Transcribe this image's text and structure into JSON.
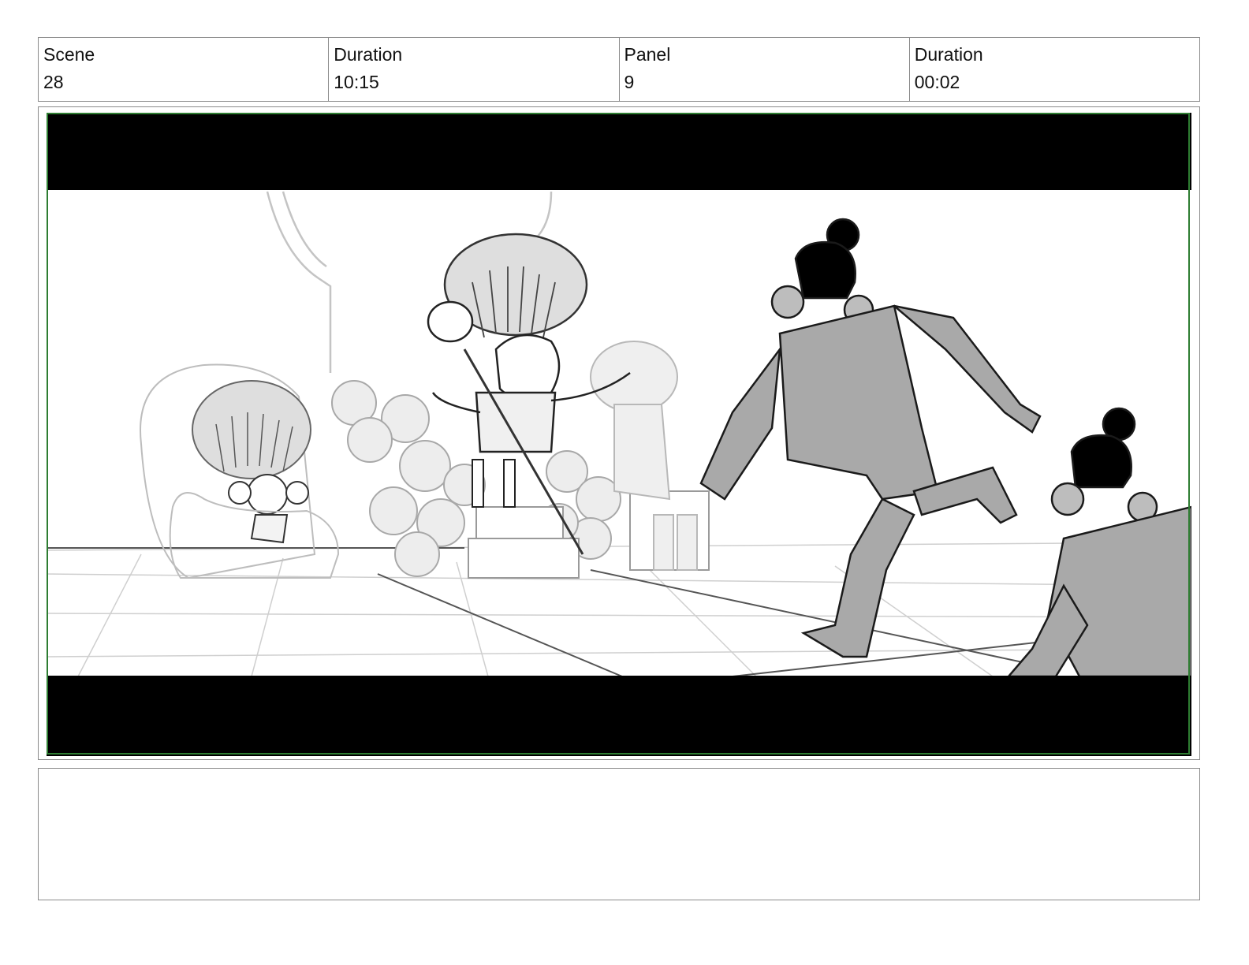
{
  "header": {
    "scene_label": "Scene",
    "scene_value": "28",
    "scene_duration_label": "Duration",
    "scene_duration_value": "10:15",
    "panel_label": "Panel",
    "panel_value": "9",
    "panel_duration_label": "Duration",
    "panel_duration_value": "00:02"
  },
  "panel": {
    "image_semantic": "storyboard-sketch-throne-room",
    "letterbox_color": "#000000",
    "frame_border_color": "#2e7d32"
  },
  "notes": {
    "text": ""
  }
}
